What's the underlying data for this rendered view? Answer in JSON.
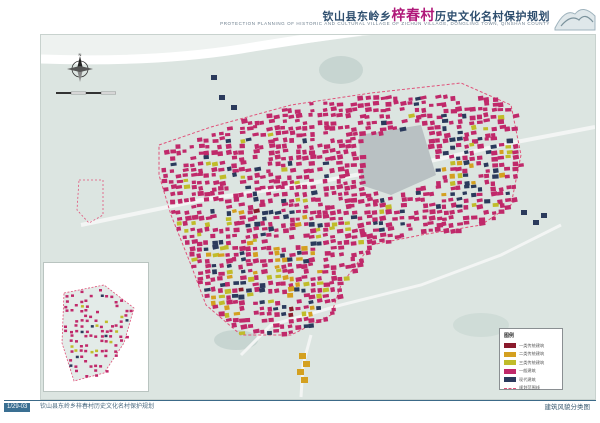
{
  "title": {
    "prefix": "钦山县东岭乡",
    "highlight": "梓春村",
    "suffix": "历史文化名村保护规划",
    "subtitle": "PROTECTION PLANNING OF HISTORIC AND CULTURAL VILLAGE OF ZICHUN VILLAGE, DONGLING TOWN, QINSHAN COUNTY"
  },
  "legend": {
    "title": "图例",
    "items": [
      {
        "label": "一类传统建筑",
        "color": "#8b1a2c",
        "kind": "fill"
      },
      {
        "label": "二类传统建筑",
        "color": "#d4a020",
        "kind": "fill"
      },
      {
        "label": "三类传统建筑",
        "color": "#c0bc2a",
        "kind": "fill"
      },
      {
        "label": "一般建筑",
        "color": "#c0296a",
        "kind": "fill"
      },
      {
        "label": "现代建筑",
        "color": "#2b3a5c",
        "kind": "fill"
      },
      {
        "label": "规划范围线",
        "color": "#e0527a",
        "kind": "line"
      }
    ]
  },
  "footer": {
    "page_code": "1/29-03",
    "left_text": "钦山县东岭乡梓春村历史文化名村保护规划",
    "right_text": "建筑风貌分类图"
  },
  "map": {
    "compass_label": "N",
    "colors": {
      "ground": "#dce5e1",
      "road": "#f3f5f4",
      "water": "#c7d5d1",
      "general": "#c0296a",
      "modern": "#2b3a5c",
      "class1": "#8b1a2c",
      "class2": "#d4a020",
      "class3": "#c0bc2a",
      "boundary": "#e0527a"
    }
  }
}
